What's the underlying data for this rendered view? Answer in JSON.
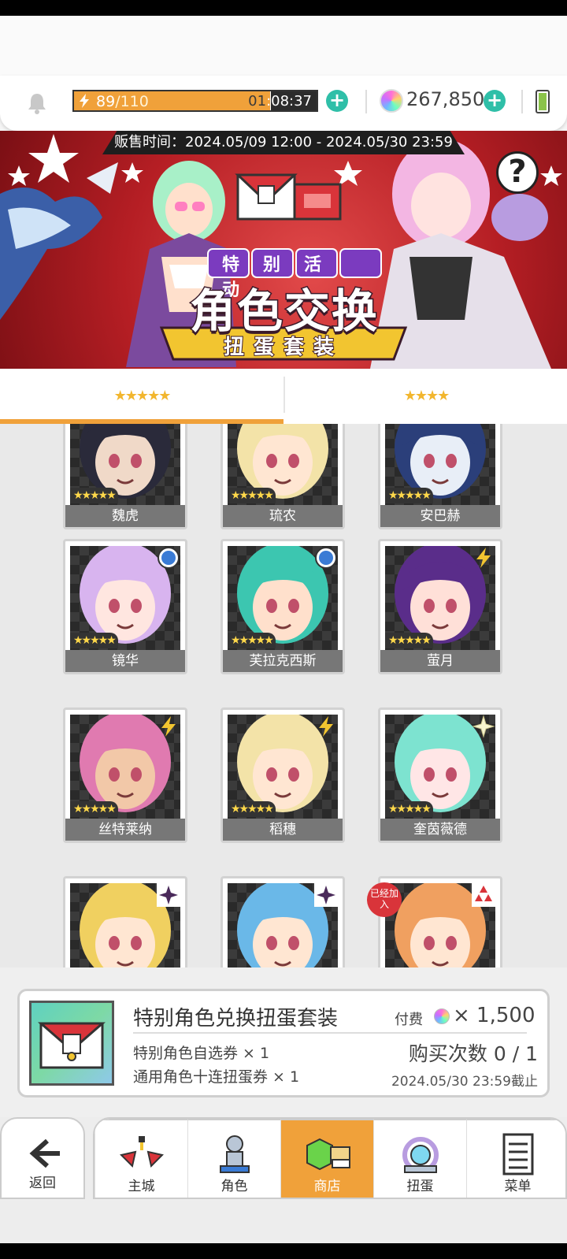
{
  "header": {
    "stamina_current": "89",
    "stamina_max": "/110",
    "stamina_fraction": 0.81,
    "stamina_timer_prefix": "01",
    "stamina_timer_rest": ":08:37",
    "gems": "267,850",
    "accent": "#f0a13a",
    "plus_color": "#2fbfa8"
  },
  "banner": {
    "sale_time": "贩售时间：2024.05/09 12:00 - 2024.05/30 23:59",
    "event_label": "特别活动",
    "title": "角色交换",
    "subtitle": "扭蛋套装",
    "help": "?"
  },
  "tabs": [
    {
      "label": "★★★★★",
      "active": true
    },
    {
      "label": "★★★★",
      "active": false
    }
  ],
  "cards": [
    {
      "name": "魏虎",
      "stars": "★★★★★",
      "badge": ""
    },
    {
      "name": "琉农",
      "stars": "★★★★★",
      "badge": ""
    },
    {
      "name": "安巴赫",
      "stars": "★★★★★",
      "badge": ""
    },
    {
      "name": "镜华",
      "stars": "★★★★★",
      "badge": "circle"
    },
    {
      "name": "芙拉克西斯",
      "stars": "★★★★★",
      "badge": "circle"
    },
    {
      "name": "萤月",
      "stars": "★★★★★",
      "badge": "bolt"
    },
    {
      "name": "丝特莱纳",
      "stars": "★★★★★",
      "badge": "bolt"
    },
    {
      "name": "稻穗",
      "stars": "★★★★★",
      "badge": "bolt"
    },
    {
      "name": "奎茵薇德",
      "stars": "★★★★★",
      "badge": "sparkle"
    },
    {
      "name": "",
      "stars": "",
      "badge": "shuriken"
    },
    {
      "name": "",
      "stars": "",
      "badge": "shuriken"
    },
    {
      "name": "",
      "stars": "",
      "badge": "diamond"
    }
  ],
  "joined_badge": "已经加入",
  "purchase": {
    "title": "特别角色兑换扭蛋套装",
    "item1": "特别角色自选券 × 1",
    "item2": "通用角色十连扭蛋券 × 1",
    "price_label": "付费",
    "price": "× 1,500",
    "buy_count": "购买次数 0 / 1",
    "deadline": "2024.05/30 23:59截止"
  },
  "nav": {
    "back": "返回",
    "items": [
      "主城",
      "角色",
      "商店",
      "扭蛋",
      "菜单"
    ],
    "active_index": 2
  }
}
